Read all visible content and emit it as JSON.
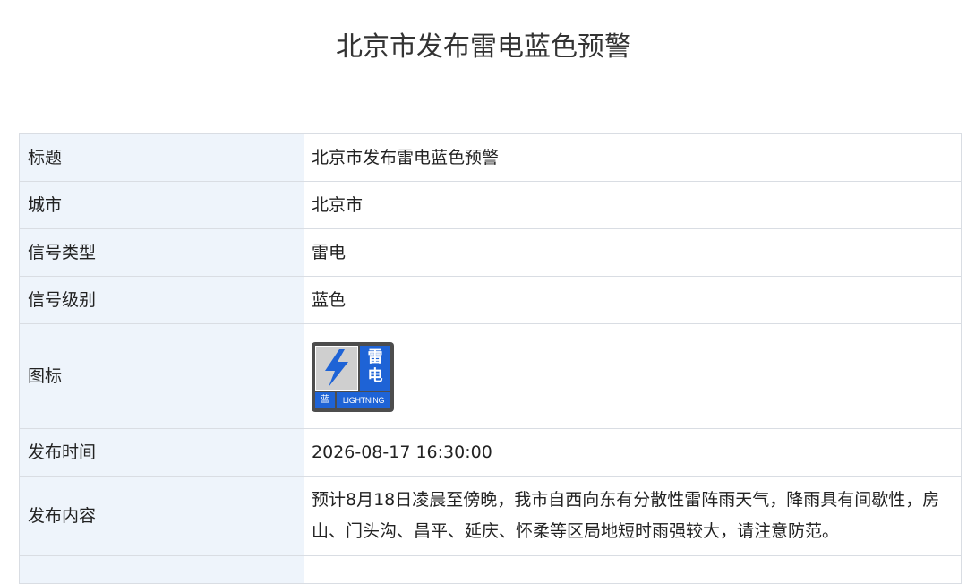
{
  "page": {
    "title": "北京市发布雷电蓝色预警"
  },
  "table": {
    "rows": [
      {
        "label": "标题",
        "value": "北京市发布雷电蓝色预警"
      },
      {
        "label": "城市",
        "value": "北京市"
      },
      {
        "label": "信号类型",
        "value": "雷电"
      },
      {
        "label": "信号级别",
        "value": "蓝色"
      },
      {
        "label": "图标"
      },
      {
        "label": "发布时间",
        "value": "2026-08-17 16:30:00"
      },
      {
        "label": "发布内容",
        "value": "预计8月18日凌晨至傍晚，我市自西向东有分散性雷阵雨天气，降雨具有间歇性，房山、门头沟、昌平、延庆、怀柔等区局地短时雨强较大，请注意防范。"
      }
    ]
  },
  "warning_icon": {
    "icon": "lightning-bolt-icon",
    "char_1": "雷",
    "char_2": "电",
    "level_text": "蓝",
    "english_text": "LIGHTNING",
    "level_color": "#1e63d6",
    "bolt_color": "#1e63d6",
    "frame_color": "#4d4d4d"
  }
}
